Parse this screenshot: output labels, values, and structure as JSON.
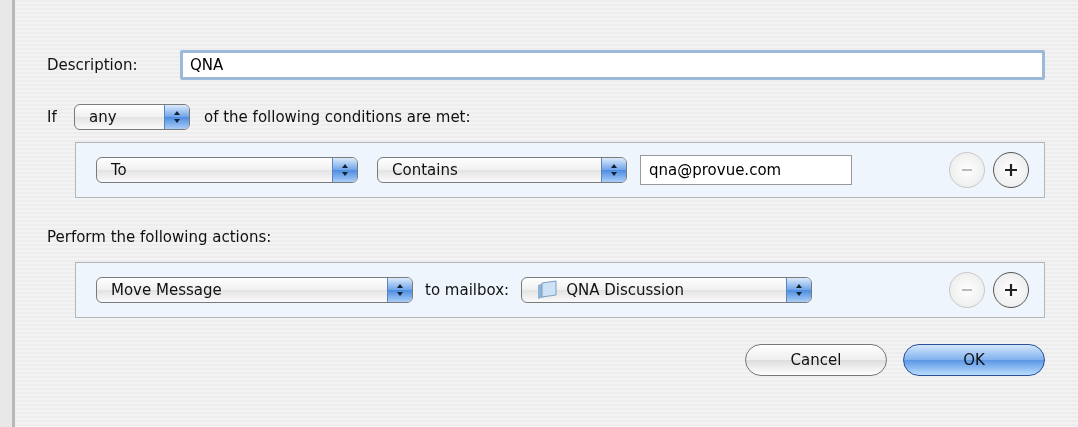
{
  "description": {
    "label": "Description:",
    "value": "QNA"
  },
  "match": {
    "prefix": "If",
    "value": "any",
    "suffix": "of the following conditions are met:"
  },
  "conditions": [
    {
      "field": "To",
      "operator": "Contains",
      "value": "qna@provue.com",
      "remove_disabled": true
    }
  ],
  "actions_label": "Perform the following actions:",
  "actions": [
    {
      "action": "Move Message",
      "connector": "to mailbox:",
      "mailbox": "QNA Discussion",
      "remove_disabled": true
    }
  ],
  "buttons": [
    {
      "label": "Cancel",
      "default": false
    },
    {
      "label": "OK",
      "default": true
    }
  ]
}
